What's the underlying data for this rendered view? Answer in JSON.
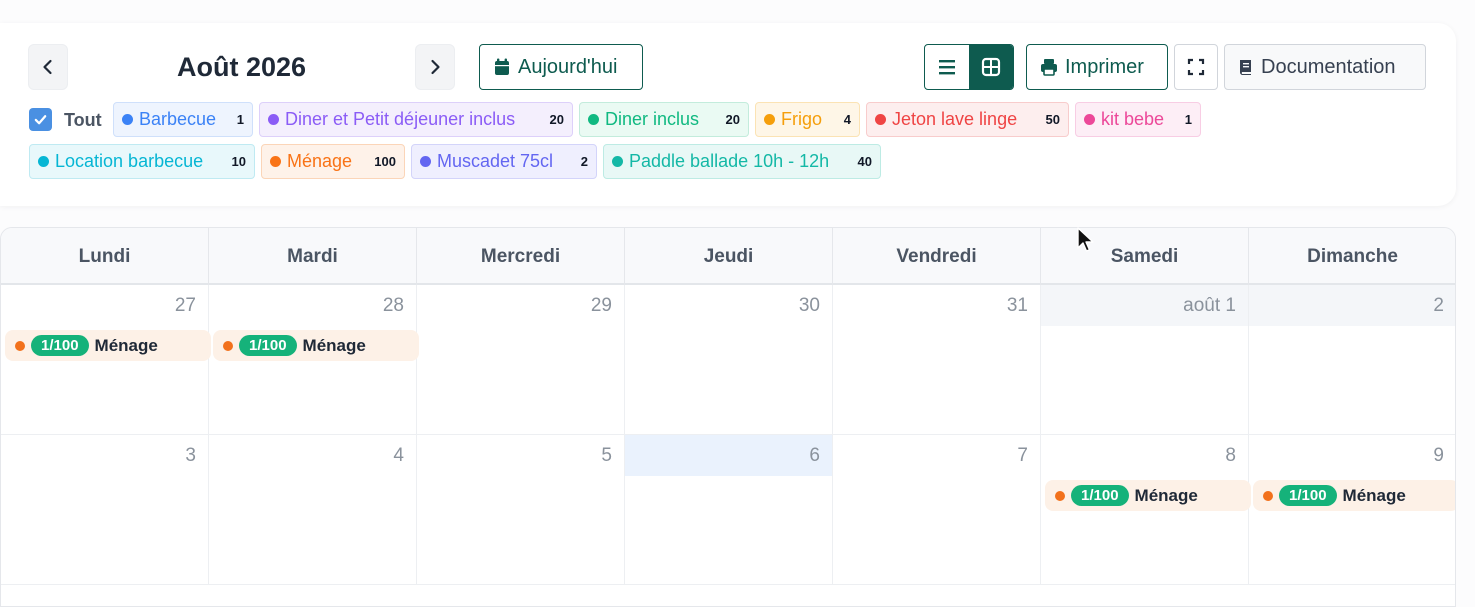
{
  "header": {
    "month_title": "Août 2026",
    "today_label": "Aujourd'hui",
    "print_label": "Imprimer",
    "doc_label": "Documentation"
  },
  "filters": {
    "all_label": "Tout",
    "all_checked": true,
    "chips": [
      {
        "label": "Barbecue",
        "count": "1",
        "color": "#3b82f6",
        "bg": "#eef4fe",
        "border": "#cfe0fb"
      },
      {
        "label": "Diner et Petit déjeuner inclus",
        "count": "20",
        "color": "#8b5cf6",
        "bg": "#f4effd",
        "border": "#ddd0fa"
      },
      {
        "label": "Diner inclus",
        "count": "20",
        "color": "#10b981",
        "bg": "#eafaf3",
        "border": "#c3ecdc"
      },
      {
        "label": "Frigo",
        "count": "4",
        "color": "#f59e0b",
        "bg": "#fef6e7",
        "border": "#fbe3b4"
      },
      {
        "label": "Jeton lave linge",
        "count": "50",
        "color": "#ef4444",
        "bg": "#fdeeee",
        "border": "#f8cccc"
      },
      {
        "label": "kit bebe",
        "count": "1",
        "color": "#ec4899",
        "bg": "#fdeef6",
        "border": "#f8cde4"
      },
      {
        "label": "Location barbecue",
        "count": "10",
        "color": "#06b6d4",
        "bg": "#e8f8fb",
        "border": "#bfeaf2"
      },
      {
        "label": "Ménage",
        "count": "100",
        "color": "#f97316",
        "bg": "#fef2e9",
        "border": "#fbd5b8"
      },
      {
        "label": "Muscadet 75cl",
        "count": "2",
        "color": "#6366f1",
        "bg": "#efeffe",
        "border": "#d3d4fa"
      },
      {
        "label": "Paddle ballade 10h - 12h",
        "count": "40",
        "color": "#14b8a6",
        "bg": "#e8f8f6",
        "border": "#bdebe4"
      }
    ]
  },
  "calendar": {
    "weekdays": [
      "Lundi",
      "Mardi",
      "Mercredi",
      "Jeudi",
      "Vendredi",
      "Samedi",
      "Dimanche"
    ],
    "weeks": [
      [
        "27",
        "28",
        "29",
        "30",
        "31",
        "août 1",
        "2"
      ],
      [
        "3",
        "4",
        "5",
        "6",
        "7",
        "8",
        "9"
      ]
    ],
    "today": "6",
    "events": [
      {
        "week": 0,
        "day": 0,
        "badge": "1/100",
        "title": "Ménage"
      },
      {
        "week": 0,
        "day": 1,
        "badge": "1/100",
        "title": "Ménage"
      },
      {
        "week": 1,
        "day": 5,
        "badge": "1/100",
        "title": "Ménage"
      },
      {
        "week": 1,
        "day": 6,
        "badge": "1/100",
        "title": "Ménage"
      }
    ]
  }
}
